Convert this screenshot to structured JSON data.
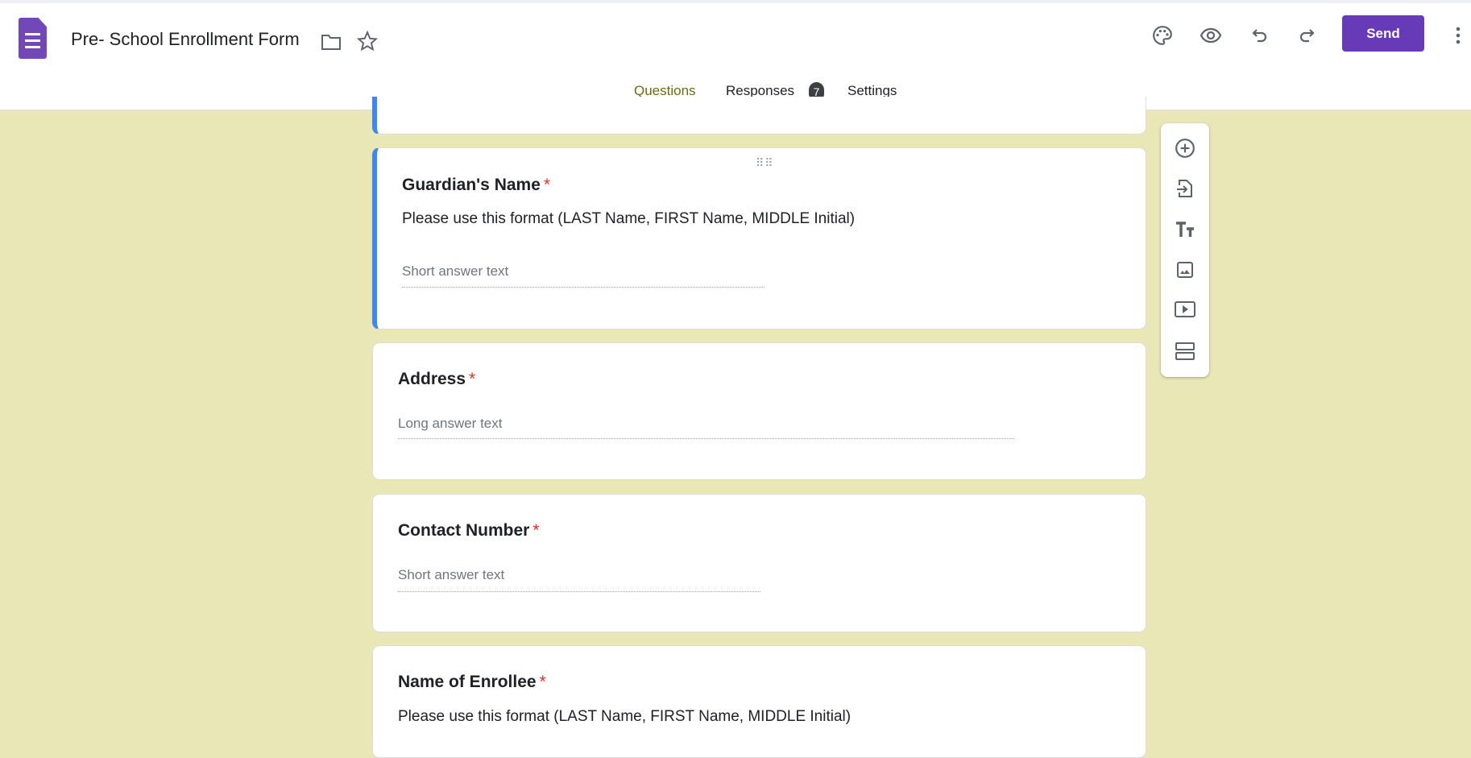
{
  "header": {
    "title": "Pre- School Enrollment Form",
    "send_label": "Send"
  },
  "tabs": [
    {
      "label": "Questions"
    },
    {
      "label": "Responses",
      "badge": "7"
    },
    {
      "label": "Settings"
    }
  ],
  "drag_handle": "⠿⠿",
  "questions": [
    {
      "title": "Guardian's Name",
      "required": "*",
      "description": "Please use this format (LAST Name, FIRST Name, MIDDLE Initial)",
      "placeholder": "Short answer text"
    },
    {
      "title": "Address",
      "required": "*",
      "placeholder": "Long answer text"
    },
    {
      "title": "Contact Number",
      "required": "*",
      "placeholder": "Short answer text"
    },
    {
      "title": "Name of Enrollee",
      "required": "*",
      "description": "Please use this format (LAST Name, FIRST Name, MIDDLE Initial)"
    }
  ],
  "colors": {
    "accent": "#673ab7",
    "tab_active": "#6d6b0f",
    "background": "#e9e7b6",
    "selected_border": "#4285f4"
  }
}
